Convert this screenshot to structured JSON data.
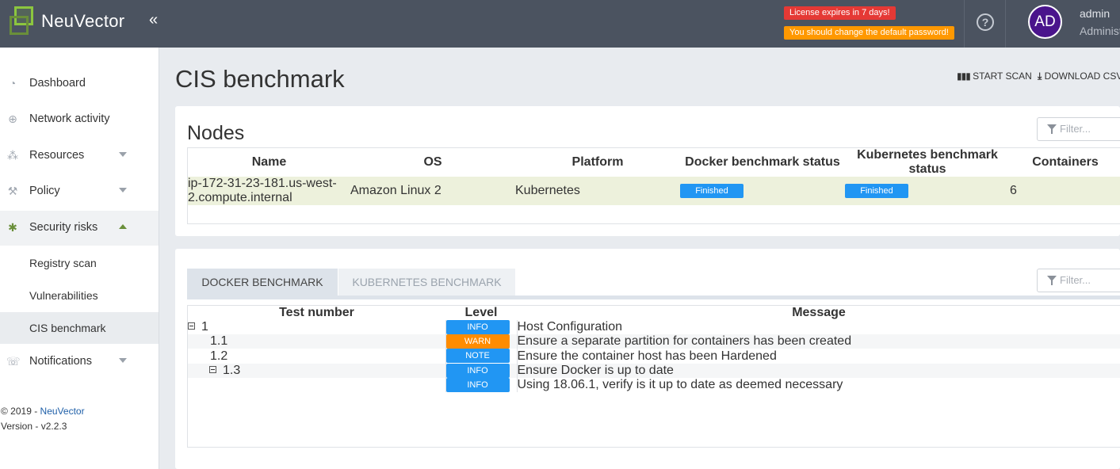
{
  "app": {
    "name": "NeuVector"
  },
  "topbar": {
    "license_badge": "License expires in 7 days!",
    "password_badge": "You should change the default password!",
    "help": "?",
    "avatar_initials": "AD",
    "user_name": "admin",
    "user_role": "Administ"
  },
  "sidebar": {
    "items": [
      {
        "label": "Dashboard",
        "icon": "dashboard-icon"
      },
      {
        "label": "Network activity",
        "icon": "globe-icon"
      },
      {
        "label": "Resources",
        "icon": "resources-icon"
      },
      {
        "label": "Policy",
        "icon": "policy-icon"
      },
      {
        "label": "Security risks",
        "icon": "bug-icon"
      },
      {
        "label": "Notifications",
        "icon": "notifications-icon"
      }
    ],
    "sub_items": [
      {
        "label": "Registry scan"
      },
      {
        "label": "Vulnerabilities"
      },
      {
        "label": "CIS benchmark"
      }
    ],
    "footer_copy": "© 2019 -",
    "footer_link": "NeuVector",
    "footer_version": "Version - v2.2.3"
  },
  "page": {
    "title": "CIS benchmark",
    "start_scan": "START SCAN",
    "download_csv": "DOWNLOAD CSV"
  },
  "nodes": {
    "title": "Nodes",
    "filter_placeholder": "Filter...",
    "columns": [
      "Name",
      "OS",
      "Platform",
      "Docker benchmark status",
      "Kubernetes benchmark status",
      "Containers"
    ],
    "rows": [
      {
        "name": "ip-172-31-23-181.us-west-2.compute.internal",
        "os": "Amazon Linux 2",
        "platform": "Kubernetes",
        "docker_status": "Finished",
        "k8s_status": "Finished",
        "containers": "6"
      }
    ]
  },
  "benchmark": {
    "tabs": [
      "DOCKER BENCHMARK",
      "KUBERNETES BENCHMARK"
    ],
    "filter_placeholder": "Filter...",
    "columns": [
      "Test number",
      "Level",
      "Message"
    ],
    "rows": [
      {
        "test": "1",
        "level": "INFO",
        "message": "Host Configuration"
      },
      {
        "test": "1.1",
        "level": "WARN",
        "message": "Ensure a separate partition for containers has been created"
      },
      {
        "test": "1.2",
        "level": "NOTE",
        "message": "Ensure the container host has been Hardened"
      },
      {
        "test": "1.3",
        "level": "INFO",
        "message": "Ensure Docker is up to date"
      },
      {
        "test": "",
        "level": "INFO",
        "message": "Using 18.06.1, verify is it up to date as deemed necessary"
      }
    ]
  },
  "colors": {
    "topbar": "#4b5360",
    "brand_green": "#8cc63f",
    "info_blue": "#2196f3",
    "warn_orange": "#ff8c00",
    "license_red": "#e53935",
    "password_orange": "#ff9800",
    "avatar_purple": "#4a148c"
  }
}
